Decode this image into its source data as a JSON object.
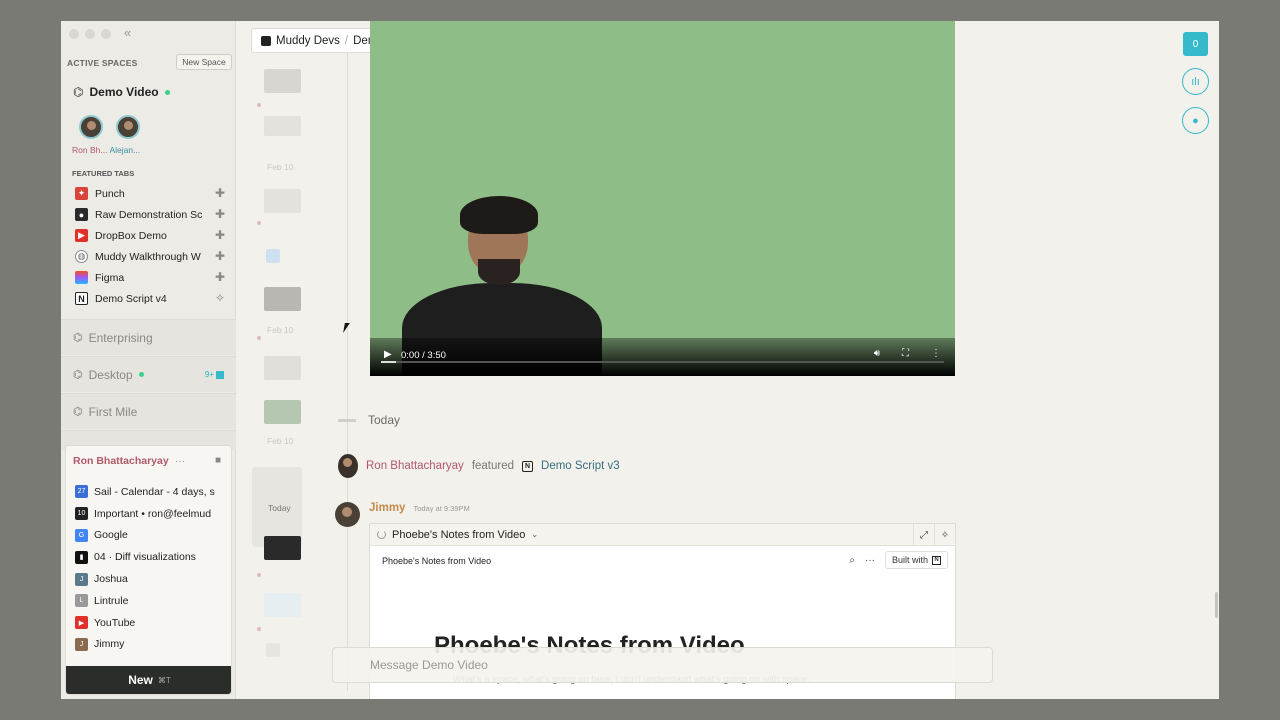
{
  "sidebar": {
    "active_spaces_label": "ACTIVE SPACES",
    "new_space_label": "New Space",
    "current_space": "Demo Video",
    "members": [
      "Ron Bh...",
      "Alejan..."
    ],
    "featured_tabs_label": "FEATURED TABS",
    "featured_tabs": [
      {
        "label": "Punch",
        "icon": "punch-icon",
        "color": "#d9433b"
      },
      {
        "label": "Raw Demonstration Sc",
        "icon": "camera-icon",
        "color": "#2a2a2a"
      },
      {
        "label": "DropBox Demo",
        "icon": "youtube-icon",
        "color": "#e0302a"
      },
      {
        "label": "Muddy Walkthrough W",
        "icon": "globe-icon",
        "color": "#888888"
      },
      {
        "label": "Figma",
        "icon": "figma-icon",
        "color": "#f24e1e"
      },
      {
        "label": "Demo Script v4",
        "icon": "notion-icon",
        "color": "#222222"
      }
    ],
    "spaces": [
      {
        "label": "Enterprising"
      },
      {
        "label": "Desktop",
        "badge": "9+"
      },
      {
        "label": "First Mile"
      }
    ]
  },
  "user_panel": {
    "name": "Ron Bhattacharyay",
    "more": "···",
    "items": [
      {
        "label": "Sail - Calendar - 4 days, s",
        "icon": "calendar-icon",
        "color": "#3b6fd1",
        "glyph": "27"
      },
      {
        "label": "Important • ron@feelmud",
        "icon": "mail-icon",
        "color": "#222222",
        "glyph": "10"
      },
      {
        "label": "Google",
        "icon": "google-icon",
        "color": "#4285f4",
        "glyph": "G"
      },
      {
        "label": "04 · Diff visualizations",
        "icon": "linear-icon",
        "color": "#111111",
        "glyph": "▮"
      },
      {
        "label": "Joshua",
        "icon": "user-icon",
        "color": "#5a7a8a",
        "glyph": "J"
      },
      {
        "label": "Lintrule",
        "icon": "lintrule-icon",
        "color": "#999999",
        "glyph": "L"
      },
      {
        "label": "YouTube",
        "icon": "youtube-icon",
        "color": "#e0302a",
        "glyph": "▶"
      },
      {
        "label": "Jimmy",
        "icon": "user-icon",
        "color": "#8a6a50",
        "glyph": "J"
      }
    ],
    "new_label": "New",
    "new_shortcut": "⌘T"
  },
  "timeline": {
    "dates": [
      "Feb 10",
      "Feb 10",
      "Feb 10"
    ],
    "today_label": "Today"
  },
  "breadcrumb": {
    "org": "Muddy Devs",
    "sep": "/",
    "space": "Demo Video"
  },
  "video": {
    "time": "0:00 / 3:50",
    "progress": 0.0
  },
  "feed": {
    "today_label": "Today",
    "featured": {
      "user": "Ron Bhattacharyay",
      "verb": "featured",
      "doc": "Demo Script v3"
    },
    "message": {
      "author": "Jimmy",
      "time": "Today at 9:39PM",
      "embed_title": "Phoebe's Notes from Video",
      "page_title_small": "Phoebe's Notes from Video",
      "built_with": "Built with",
      "page_heading": "Phoebe's Notes from Video",
      "page_body": "What's a space, what's going on here, I don't understand what's going on with space."
    }
  },
  "composer": {
    "placeholder": "Message Demo Video"
  },
  "rail": {
    "count": "0"
  }
}
